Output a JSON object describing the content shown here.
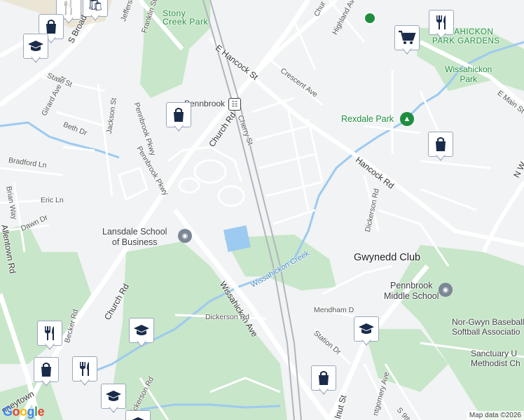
{
  "map": {
    "attribution": "Map data ©2026",
    "logo": "Google",
    "colors": {
      "background": "#f1f3f4",
      "park": "#c8e6c9",
      "water": "#9ccaf0",
      "road": "#ffffff",
      "rail": "#b0b6bd",
      "marker_icon": "#1a2b4a"
    }
  },
  "labels": {
    "stony_creek_park": "Stony\nCreek Park",
    "jefferson": "Jefferson",
    "franklin_st": "Franklin St",
    "s_broad_st": "S Broad St",
    "e_hancock_st": "E Hancock St",
    "pennbrook": "Pennbrook",
    "church_rd_upper": "Church Rd",
    "cherry_st": "Cherry St",
    "crescent_ave": "Crescent Ave",
    "highland_ave": "Highland Ave",
    "church_top": "Chur",
    "wissahickon_park_gardens": "WISSAHICKON\nPARK GARDENS",
    "wissahickon_park": "Wissahickon\nPark",
    "e_main_st": "E Main St",
    "rexdale_park": "Rexdale Park",
    "hancock_rd": "Hancock Rd",
    "n_w": "N W",
    "state_st": "State St",
    "girard_ave_st": "Girard Ave St",
    "beth_dr": "Beth Dr",
    "jackson_st": "Jackson St",
    "pennbrook_pkwy_a": "Pennbrook Pkwy",
    "pennbrook_pkwy_b": "Pennbrook Pkwy",
    "bradford_ln": "Bradford Ln",
    "brian_way": "Brian Way",
    "eric_ln": "Eric Ln",
    "dawn_dr": "Dawn Dr",
    "allentown_rd": "Allentown Rd",
    "lansdale_school": "Lansdale School\nof Business",
    "dickerson_rd_right": "Dickerson Rd",
    "gwynedd_club": "Gwynedd Club",
    "wissahickon_creek": "Wissahickon Creek",
    "church_rd_lower": "Church Rd",
    "wissahickon_ave": "Wissahickon Ave",
    "pennbrook_middle": "Pennbrook\nMiddle School",
    "nor_gwyn": "Nor-Gwyn Baseball an\nSoftball Associatio",
    "mendham_dr": "Mendham D",
    "station_dr": "Station Dr",
    "sanctuary": "Sanctuary U\nMethodist Ch",
    "dickerson_rd_lower": "Dickerson Rd",
    "becker_rd": "Becker Rd",
    "dickerson_rd_left": "Dickerson Rd",
    "menneytown": "nneytown",
    "walnut_st": "lnut St",
    "montgomery_ave": "ntgomery Ave",
    "s_9th_st": "S 9th S"
  },
  "markers": [
    {
      "name": "restaurant-marker-top",
      "icon": "restaurant-icon"
    },
    {
      "name": "shopping-marker-top",
      "icon": "shopping-bag-icon"
    },
    {
      "name": "school-marker-top-left",
      "icon": "school-icon"
    },
    {
      "name": "restaurant-marker-top-right",
      "icon": "restaurant-icon"
    },
    {
      "name": "grocery-marker",
      "icon": "shopping-cart-icon"
    },
    {
      "name": "shopping-marker-pennbrook",
      "icon": "shopping-bag-icon"
    },
    {
      "name": "shopping-marker-right",
      "icon": "shopping-bag-icon"
    },
    {
      "name": "school-marker-mendham",
      "icon": "school-icon"
    },
    {
      "name": "school-marker-dickerson",
      "icon": "school-icon"
    },
    {
      "name": "restaurant-marker-lower-1",
      "icon": "restaurant-icon"
    },
    {
      "name": "shopping-marker-lower",
      "icon": "shopping-bag-icon"
    },
    {
      "name": "restaurant-marker-lower-2",
      "icon": "restaurant-icon"
    },
    {
      "name": "school-marker-bottom",
      "icon": "school-icon"
    },
    {
      "name": "shopping-marker-bottom",
      "icon": "shopping-bag-icon"
    }
  ]
}
